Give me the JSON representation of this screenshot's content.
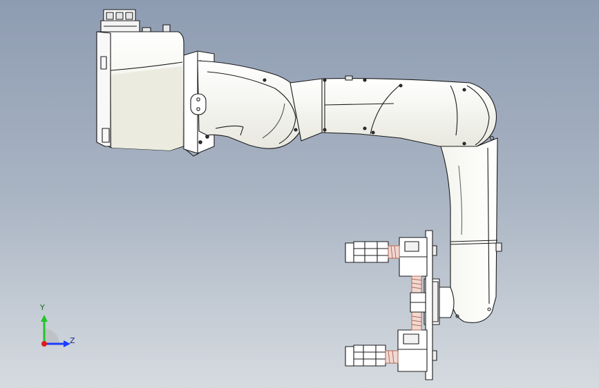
{
  "viewport": {
    "background_top": "#8e9cb2",
    "background_bottom": "#d6dbe0"
  },
  "model": {
    "body_color": "#ffffff",
    "edge_color": "#1a1a1a",
    "shade_color": "#c9c9b8"
  },
  "triad": {
    "y_label": "Y",
    "z_label": "Z",
    "y_color": "#22c42a",
    "z_color": "#1e3cff",
    "x_color": "#e01a1a"
  }
}
